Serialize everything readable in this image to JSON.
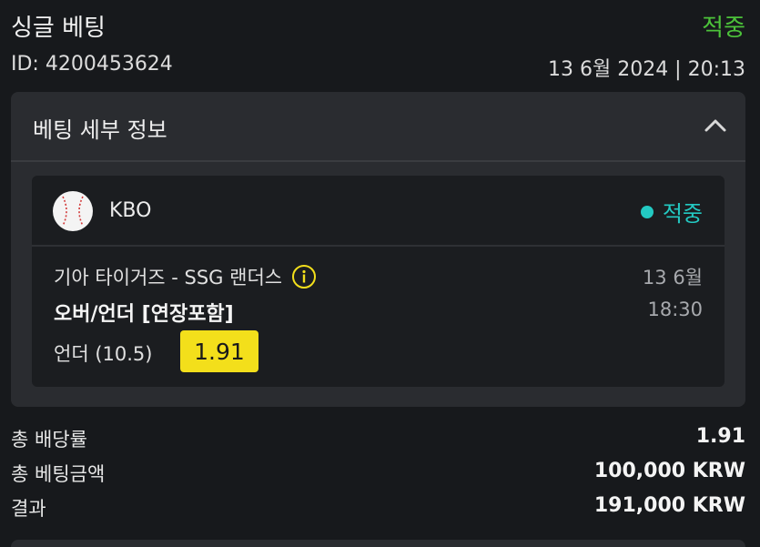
{
  "header": {
    "title": "싱글 베팅",
    "result": "적중",
    "bet_id": "ID: 4200453624",
    "datetime": "13 6월 2024 | 20:13"
  },
  "details": {
    "title": "베팅 세부 정보",
    "toggle_icon": "chevron-up-icon",
    "event": {
      "league_icon": "baseball-icon",
      "league": "KBO",
      "status": "적중",
      "match": "기아 타이거즈 - SSG 랜더스",
      "info_icon": "info-icon",
      "date": "13 6월",
      "market": "오버/언더 [연장포함]",
      "time": "18:30",
      "selection": "언더 (10.5)",
      "odds": "1.91"
    }
  },
  "summary": {
    "total_odds_label": "총 배당률",
    "total_odds_value": "1.91",
    "total_stake_label": "총 베팅금액",
    "total_stake_value": "100,000 KRW",
    "result_label": "결과",
    "result_value": "191,000 KRW"
  },
  "colors": {
    "win_green": "#4cc23a",
    "status_teal": "#23c9c2",
    "odds_yellow": "#f3df1b",
    "background": "#17191c",
    "card": "#2a2c30"
  }
}
